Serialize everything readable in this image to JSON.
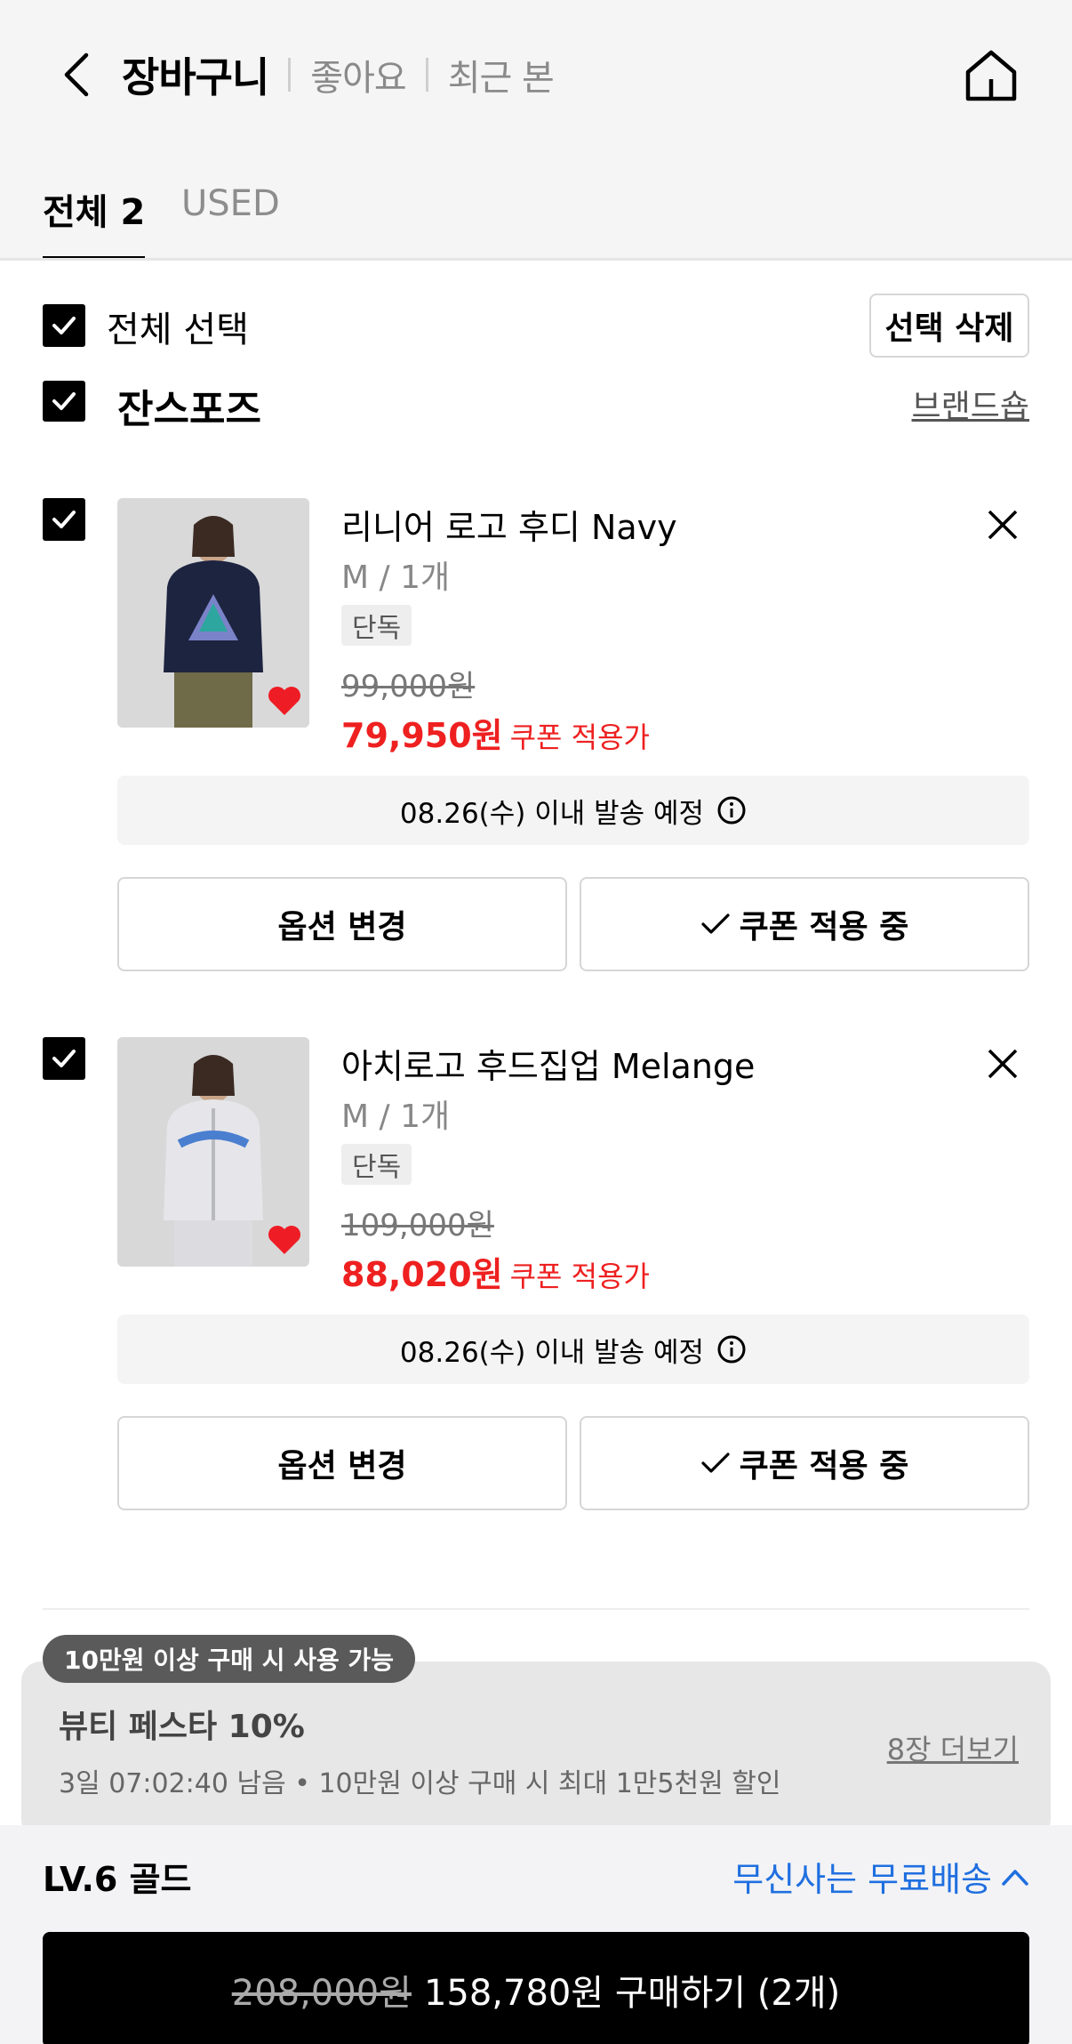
{
  "header": {
    "title": "장바구니",
    "links": [
      "좋아요",
      "최근 본"
    ]
  },
  "tabs": {
    "all": "전체 2",
    "used": "USED"
  },
  "select_all": {
    "label": "전체 선택",
    "delete_label": "선택 삭제"
  },
  "brand": {
    "name": "잔스포즈",
    "shop_link": "브랜드숍"
  },
  "products": [
    {
      "name": "리니어 로고 후디 Navy",
      "option": "M / 1개",
      "badge": "단독",
      "original_price": "99,000원",
      "price": "79,950원",
      "price_label": "쿠폰 적용가",
      "shipping": "08.26(수) 이내 발송 예정",
      "change_option": "옵션 변경",
      "coupon_status": "쿠폰 적용 중"
    },
    {
      "name": "아치로고 후드집업 Melange",
      "option": "M / 1개",
      "badge": "단독",
      "original_price": "109,000원",
      "price": "88,020원",
      "price_label": "쿠폰 적용가",
      "shipping": "08.26(수) 이내 발송 예정",
      "change_option": "옵션 변경",
      "coupon_status": "쿠폰 적용 중"
    }
  ],
  "coupon": {
    "badge": "10만원 이상 구매 시 사용 가능",
    "title": "뷰티 페스타 10%",
    "description": "3일 07:02:40 남음 • 10만원 이상 구매 시 최대 1만5천원 할인",
    "more": "8장 더보기"
  },
  "bottom": {
    "level": "LV.6 골드",
    "free_shipping": "무신사는 무료배송",
    "original_total": "208,000원",
    "buy_label": "158,780원 구매하기 (2개)"
  },
  "colors": {
    "accent_red": "#ee2020",
    "accent_blue": "#1f6fe0",
    "header_bg": "#f5f5f5"
  }
}
